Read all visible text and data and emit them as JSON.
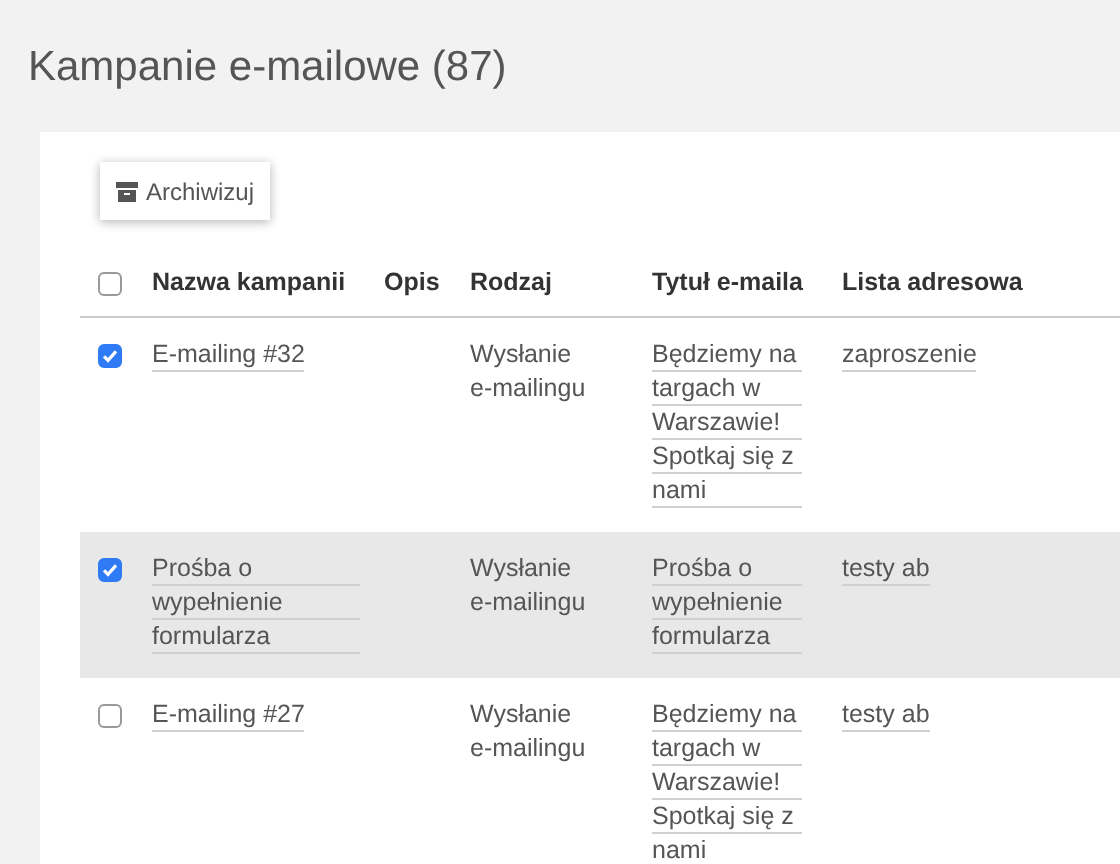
{
  "page_title": "Kampanie e-mailowe (87)",
  "toolbar": {
    "archive_button": "Archiwizuj"
  },
  "table": {
    "select_all_checked": false,
    "columns": [
      "Nazwa kampanii",
      "Opis",
      "Rodzaj",
      "Tytuł e-maila",
      "Lista adresowa"
    ],
    "rows": [
      {
        "checked": true,
        "highlighted": false,
        "name": "E-mailing #32",
        "description": "",
        "type": "Wysłanie e-mailingu",
        "email_title": "Będziemy na targach w Warszawie! Spotkaj się z nami",
        "list": "zaproszenie"
      },
      {
        "checked": true,
        "highlighted": true,
        "name": "Prośba o wypełnienie formularza",
        "description": "",
        "type": "Wysłanie e-mailingu",
        "email_title": "Prośba o wypełnienie formularza",
        "list": "testy ab"
      },
      {
        "checked": false,
        "highlighted": false,
        "name": "E-mailing #27",
        "description": "",
        "type": "Wysłanie e-mailingu",
        "email_title": "Będziemy na targach w Warszawie! Spotkaj się z nami",
        "list": "testy ab"
      }
    ]
  }
}
